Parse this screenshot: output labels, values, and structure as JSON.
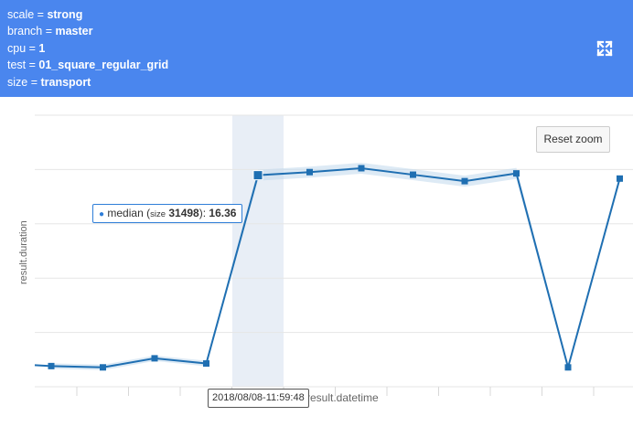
{
  "params": [
    {
      "key": "scale",
      "value": "strong"
    },
    {
      "key": "branch",
      "value": "master"
    },
    {
      "key": "cpu",
      "value": "1"
    },
    {
      "key": "test",
      "value": "01_square_regular_grid"
    },
    {
      "key": "size",
      "value": "transport"
    }
  ],
  "icons": {
    "expand": "expand-icon"
  },
  "buttons": {
    "reset_zoom": "Reset zoom"
  },
  "tooltip": {
    "bullet": "●",
    "series": "median",
    "size_label": "size",
    "size_value": "31498",
    "value": "16.36"
  },
  "x_crosshair_label": "2018/08/08-11:59:48",
  "colors": {
    "header": "#4a86ee",
    "series": "#1f6fb2",
    "band": "#c6dcef",
    "highlight": "#e8eef6"
  },
  "chart_data": {
    "type": "line",
    "xlabel": "result.datetime",
    "ylabel": "result.duration",
    "grid": true,
    "legend": "none",
    "series": [
      {
        "name": "median",
        "x": [
          0,
          1,
          2,
          3,
          4,
          5,
          6,
          7,
          8,
          9,
          10,
          11
        ],
        "values": [
          1.6,
          1.5,
          2.2,
          1.8,
          16.36,
          16.6,
          16.9,
          16.4,
          15.9,
          16.5,
          1.5,
          16.1
        ]
      }
    ],
    "highlight_index": 4
  }
}
